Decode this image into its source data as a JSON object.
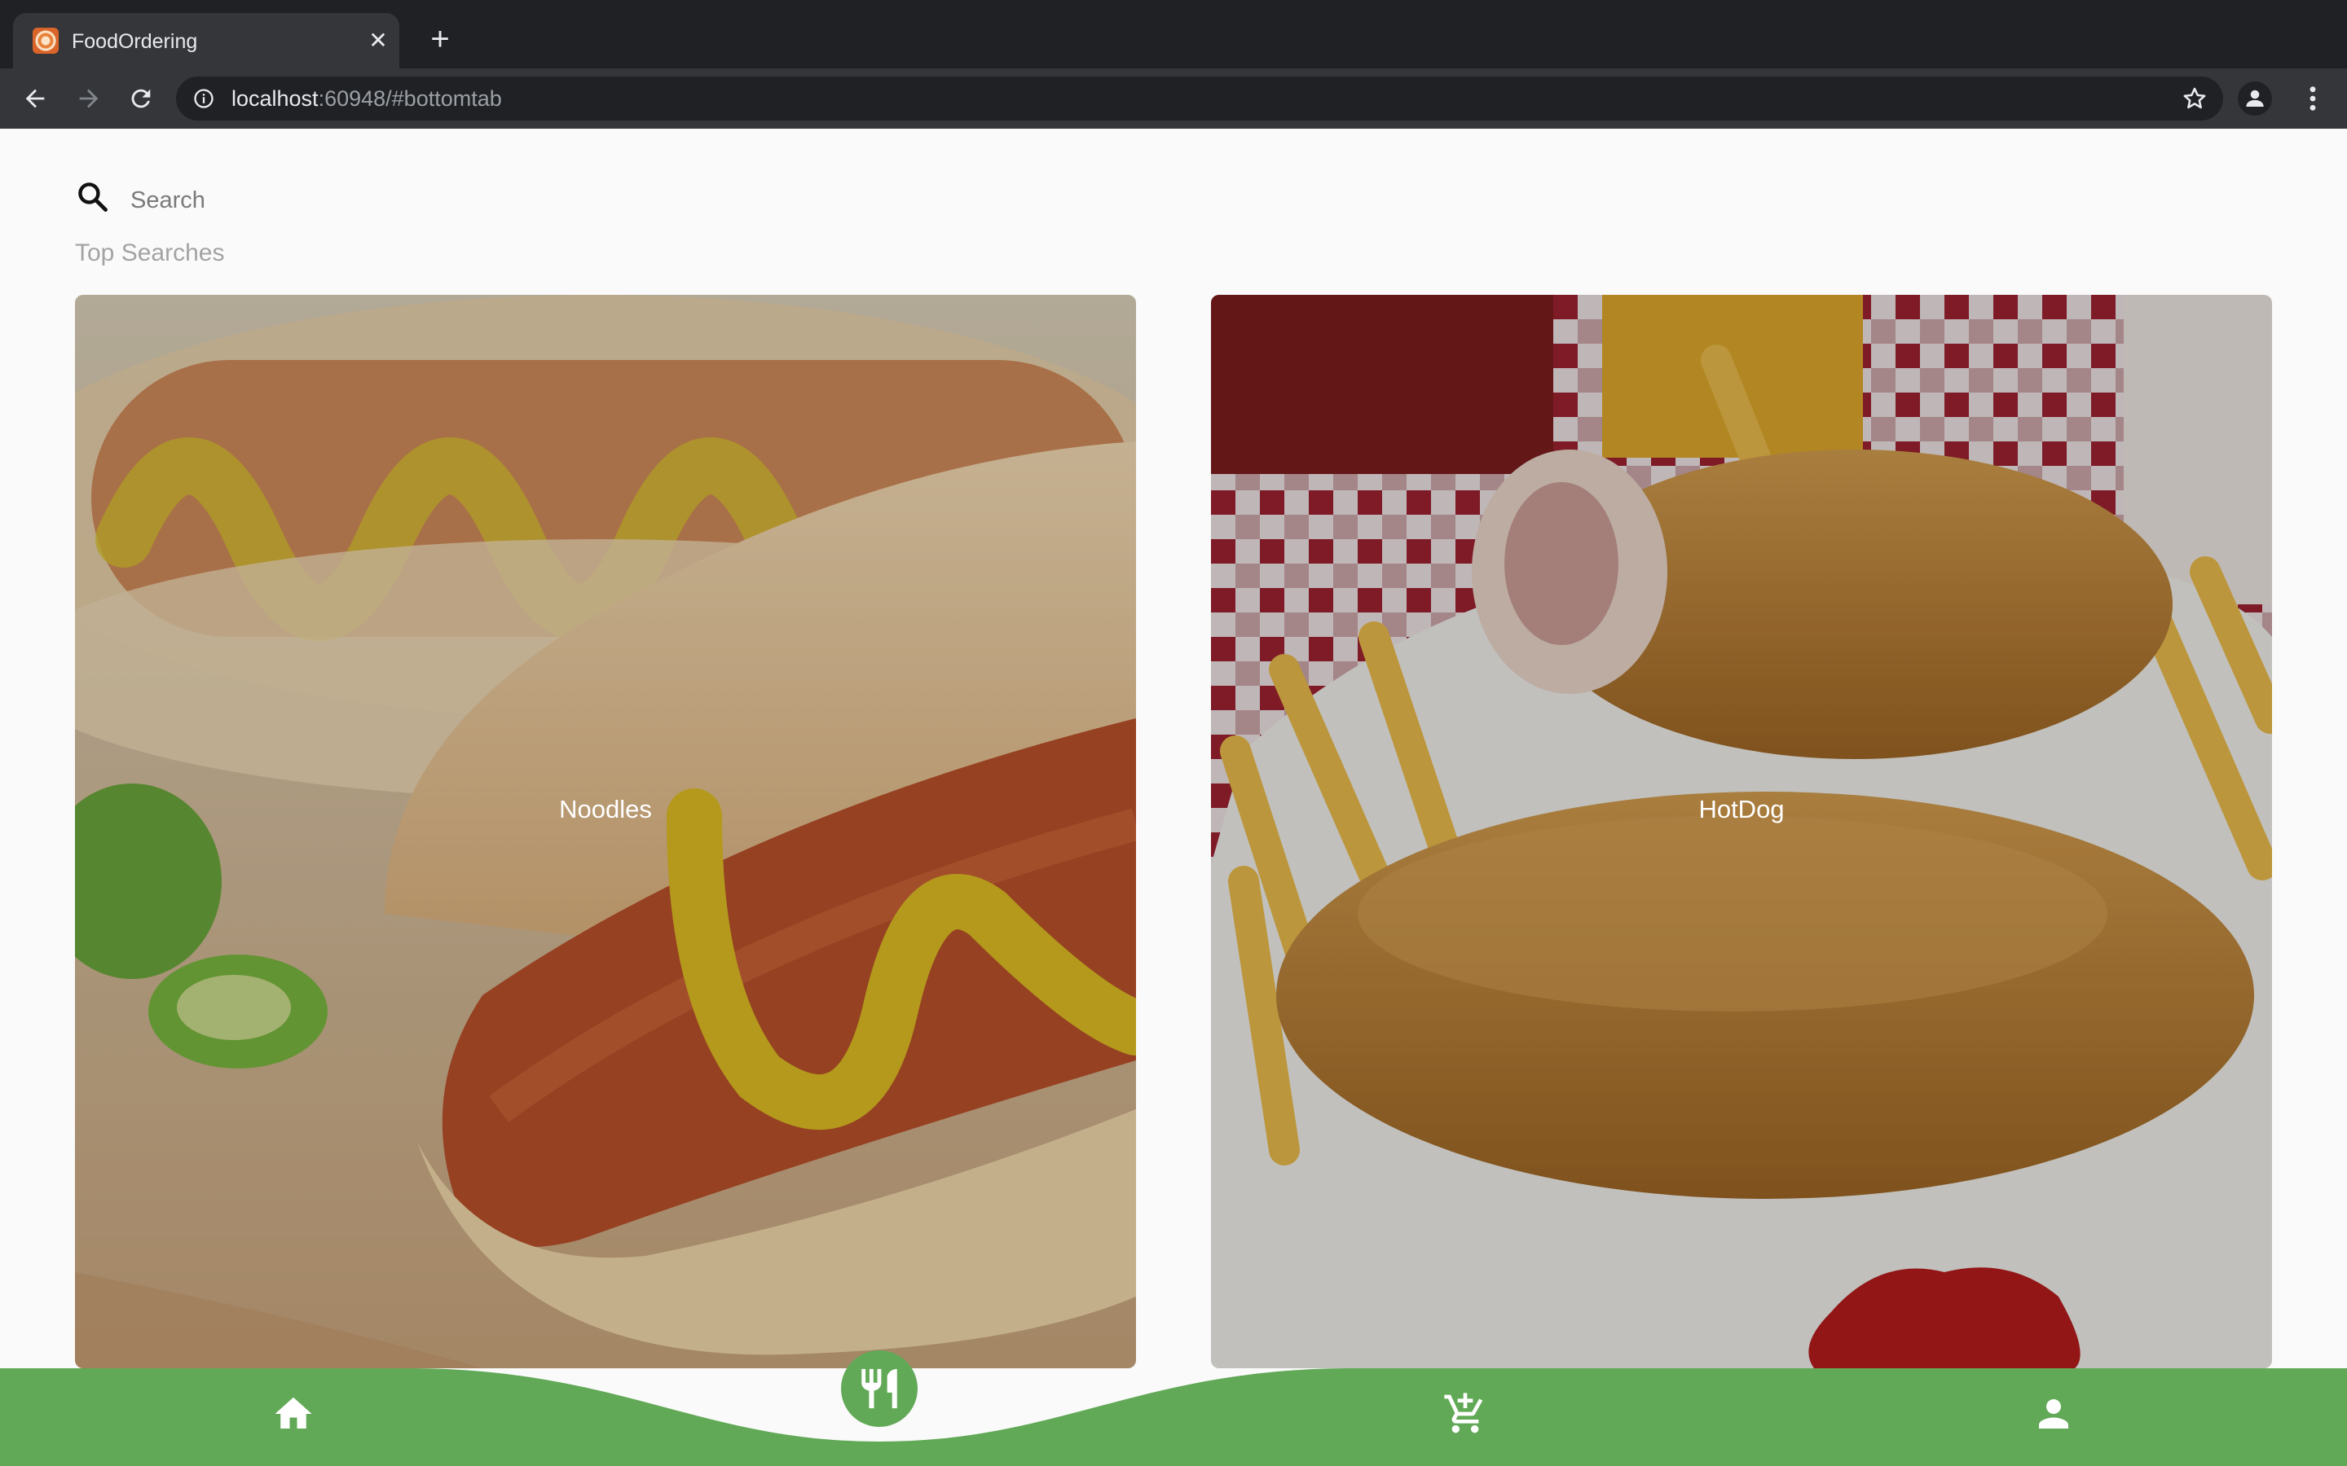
{
  "browser": {
    "tab_title": "FoodOrdering",
    "url_host": "localhost",
    "url_rest": ":60948/#bottomtab"
  },
  "search": {
    "placeholder": "Search"
  },
  "section_title": "Top Searches",
  "items": [
    {
      "label": "Noodles"
    },
    {
      "label": "HotDog"
    }
  ],
  "bottom_nav": {
    "items": [
      "home-icon",
      "restaurant-icon",
      "add-to-cart-icon",
      "person-icon"
    ],
    "active": "restaurant-icon",
    "colors": {
      "bar": "#62a957",
      "icon": "#ffffff"
    }
  }
}
